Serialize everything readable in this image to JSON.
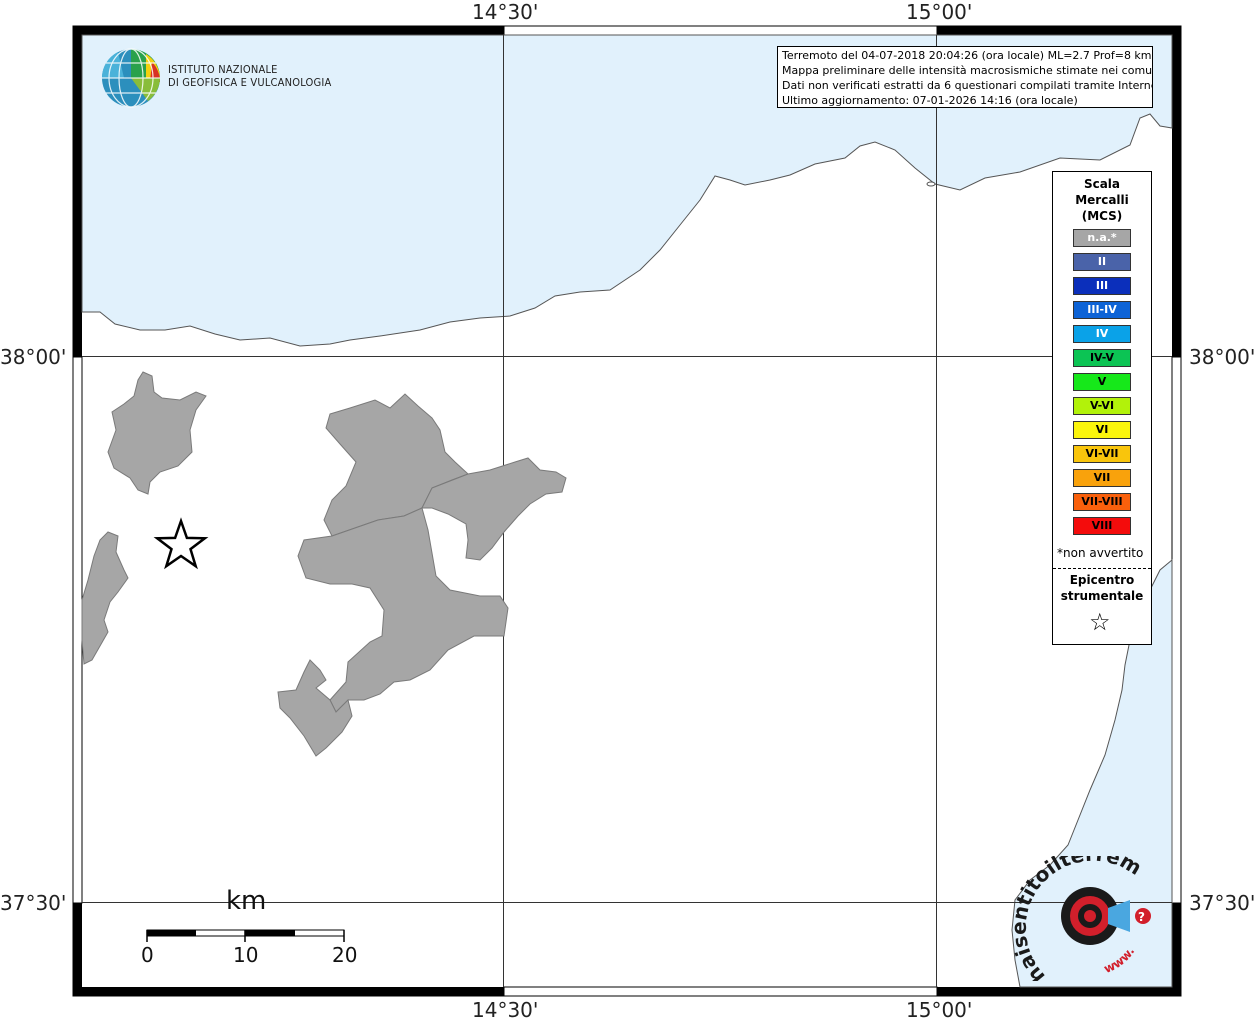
{
  "map": {
    "longitude_labels": [
      "14°30'",
      "15°00'"
    ],
    "latitude_labels": [
      "38°00'",
      "37°30'"
    ]
  },
  "info": {
    "line1": "Terremoto del 04-07-2018 20:04:26 (ora locale) ML=2.7 Prof=8 km",
    "line2": "Mappa preliminare delle intensità macrosismiche stimate nei comuni",
    "line3": "Dati non verificati estratti da 6 questionari compilati tramite Internet.",
    "line4": "Ultimo aggiornamento: 07-01-2026 14:16 (ora locale)"
  },
  "logo": {
    "line1": "ISTITUTO NAZIONALE",
    "line2": "DI GEOFISICA E VULCANOLOGIA"
  },
  "legend": {
    "title_line1": "Scala",
    "title_line2": "Mercalli",
    "title_line3": "(MCS)",
    "items": [
      {
        "label": "n.a.*",
        "color": "#a6a6a6"
      },
      {
        "label": "II",
        "color": "#4a63a9"
      },
      {
        "label": "III",
        "color": "#0b2fbb"
      },
      {
        "label": "III-IV",
        "color": "#0d63d6"
      },
      {
        "label": "IV",
        "color": "#0aa2e8"
      },
      {
        "label": "IV-V",
        "color": "#0cc454"
      },
      {
        "label": "V",
        "color": "#16e81a"
      },
      {
        "label": "V-VI",
        "color": "#b2f20a"
      },
      {
        "label": "VI",
        "color": "#fbf50c"
      },
      {
        "label": "VI-VII",
        "color": "#f9c50c"
      },
      {
        "label": "VII",
        "color": "#f9a20c"
      },
      {
        "label": "VII-VIII",
        "color": "#f9600c"
      },
      {
        "label": "VIII",
        "color": "#f40c0c"
      }
    ],
    "note": "*non avvertito",
    "epicenter_line1": "Epicentro",
    "epicenter_line2": "strumentale",
    "epicenter_symbol": "☆"
  },
  "scalebar": {
    "unit": "km",
    "ticks": [
      "0",
      "10",
      "20"
    ]
  },
  "watermark": {
    "text": "haisentitoilterremoto.it",
    "url": "www.",
    "question": "?"
  },
  "colors": {
    "sea": "#e1f1fc",
    "land": "#ffffff",
    "municipality_na": "#a6a6a6",
    "grid": "#333333"
  }
}
